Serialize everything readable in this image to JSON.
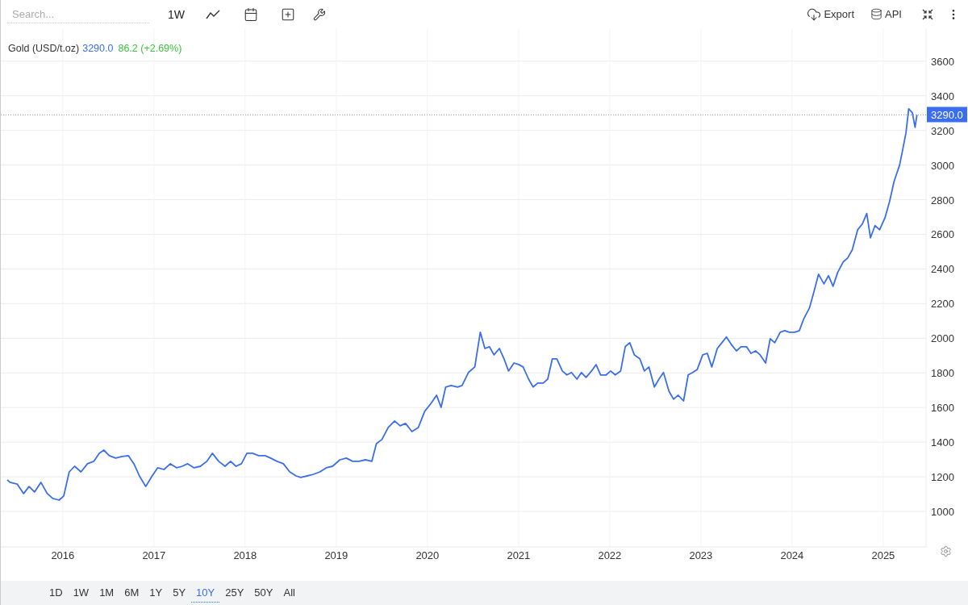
{
  "toolbar": {
    "search": {
      "placeholder": "Search..."
    },
    "interval": "1W",
    "export": "Export",
    "api": "API"
  },
  "chart": {
    "title": "Gold (USD/t.oz)",
    "last": "3290.0",
    "change": "86.2 (+2.69%)",
    "price_tag": "3290.0",
    "chart_data": {
      "type": "line",
      "xlim": [
        2015.32,
        2025.47
      ],
      "ylim": [
        795,
        3790
      ],
      "xticks": [
        2016,
        2017,
        2018,
        2019,
        2020,
        2021,
        2022,
        2023,
        2024,
        2025
      ],
      "yticks": [
        1000,
        1200,
        1400,
        1600,
        1800,
        2000,
        2200,
        2400,
        2600,
        2800,
        3000,
        3200,
        3400,
        3600
      ],
      "x": [
        2015.39,
        2015.42,
        2015.5,
        2015.57,
        2015.63,
        2015.69,
        2015.76,
        2015.83,
        2015.89,
        2015.96,
        2016.01,
        2016.07,
        2016.13,
        2016.2,
        2016.27,
        2016.34,
        2016.4,
        2016.45,
        2016.51,
        2016.58,
        2016.65,
        2016.72,
        2016.78,
        2016.84,
        2016.91,
        2016.98,
        2017.04,
        2017.11,
        2017.18,
        2017.25,
        2017.31,
        2017.37,
        2017.44,
        2017.51,
        2017.58,
        2017.64,
        2017.71,
        2017.78,
        2017.84,
        2017.9,
        2017.96,
        2018.02,
        2018.08,
        2018.15,
        2018.22,
        2018.28,
        2018.35,
        2018.42,
        2018.49,
        2018.56,
        2018.61,
        2018.68,
        2018.75,
        2018.82,
        2018.89,
        2018.96,
        2019.04,
        2019.11,
        2019.18,
        2019.25,
        2019.32,
        2019.39,
        2019.44,
        2019.5,
        2019.57,
        2019.64,
        2019.7,
        2019.76,
        2019.83,
        2019.9,
        2019.97,
        2020.04,
        2020.1,
        2020.15,
        2020.2,
        2020.26,
        2020.33,
        2020.38,
        2020.45,
        2020.52,
        2020.58,
        2020.63,
        2020.68,
        2020.73,
        2020.79,
        2020.84,
        2020.89,
        2020.95,
        2021.0,
        2021.05,
        2021.11,
        2021.16,
        2021.21,
        2021.27,
        2021.32,
        2021.37,
        2021.42,
        2021.48,
        2021.53,
        2021.58,
        2021.64,
        2021.69,
        2021.74,
        2021.8,
        2021.85,
        2021.9,
        2021.96,
        2022.01,
        2022.06,
        2022.12,
        2022.17,
        2022.22,
        2022.27,
        2022.33,
        2022.38,
        2022.43,
        2022.49,
        2022.54,
        2022.59,
        2022.65,
        2022.7,
        2022.75,
        2022.81,
        2022.86,
        2022.91,
        2022.96,
        2023.02,
        2023.07,
        2023.12,
        2023.18,
        2023.23,
        2023.28,
        2023.34,
        2023.39,
        2023.44,
        2023.5,
        2023.55,
        2023.6,
        2023.65,
        2023.71,
        2023.76,
        2023.81,
        2023.87,
        2023.92,
        2023.97,
        2024.03,
        2024.08,
        2024.13,
        2024.19,
        2024.24,
        2024.29,
        2024.35,
        2024.4,
        2024.45,
        2024.5,
        2024.56,
        2024.61,
        2024.66,
        2024.72,
        2024.77,
        2024.82,
        2024.86,
        2024.91,
        2024.96,
        2025.02,
        2025.07,
        2025.12,
        2025.18,
        2025.21,
        2025.25,
        2025.28,
        2025.32,
        2025.35,
        2025.37
      ],
      "grid": true,
      "ref_lines": [
        {
          "axis": "y",
          "value": 3290
        }
      ],
      "series": [
        {
          "color": "#3a6df0",
          "values": [
            1182,
            1168,
            1158,
            1103,
            1144,
            1112,
            1168,
            1103,
            1075,
            1065,
            1089,
            1228,
            1261,
            1228,
            1275,
            1289,
            1336,
            1354,
            1322,
            1308,
            1317,
            1322,
            1275,
            1205,
            1144,
            1205,
            1252,
            1242,
            1275,
            1252,
            1261,
            1275,
            1252,
            1261,
            1289,
            1336,
            1289,
            1261,
            1289,
            1261,
            1275,
            1336,
            1336,
            1322,
            1322,
            1308,
            1289,
            1275,
            1228,
            1205,
            1196,
            1205,
            1214,
            1228,
            1252,
            1261,
            1298,
            1308,
            1289,
            1289,
            1298,
            1289,
            1391,
            1415,
            1485,
            1522,
            1494,
            1508,
            1461,
            1485,
            1578,
            1624,
            1671,
            1601,
            1718,
            1727,
            1718,
            1727,
            1802,
            1834,
            2035,
            1941,
            1951,
            1904,
            1941,
            1881,
            1811,
            1857,
            1848,
            1834,
            1764,
            1718,
            1741,
            1741,
            1764,
            1881,
            1881,
            1811,
            1788,
            1802,
            1764,
            1802,
            1774,
            1811,
            1848,
            1788,
            1788,
            1811,
            1788,
            1811,
            1951,
            1974,
            1904,
            1881,
            1811,
            1834,
            1718,
            1764,
            1802,
            1694,
            1648,
            1671,
            1638,
            1788,
            1802,
            1820,
            1904,
            1913,
            1834,
            1941,
            1974,
            2007,
            1960,
            1927,
            1951,
            1951,
            1913,
            1927,
            1904,
            1857,
            1997,
            1974,
            2035,
            2044,
            2035,
            2035,
            2044,
            2114,
            2174,
            2268,
            2370,
            2314,
            2361,
            2300,
            2379,
            2440,
            2463,
            2510,
            2626,
            2659,
            2720,
            2580,
            2650,
            2626,
            2696,
            2790,
            2906,
            3000,
            3078,
            3186,
            3325,
            3302,
            3218,
            3290
          ]
        }
      ]
    }
  },
  "ranges": [
    {
      "label": "1D",
      "selected": false
    },
    {
      "label": "1W",
      "selected": false
    },
    {
      "label": "1M",
      "selected": false
    },
    {
      "label": "6M",
      "selected": false
    },
    {
      "label": "1Y",
      "selected": false
    },
    {
      "label": "5Y",
      "selected": false
    },
    {
      "label": "10Y",
      "selected": true
    },
    {
      "label": "25Y",
      "selected": false
    },
    {
      "label": "50Y",
      "selected": false
    },
    {
      "label": "All",
      "selected": false
    }
  ]
}
